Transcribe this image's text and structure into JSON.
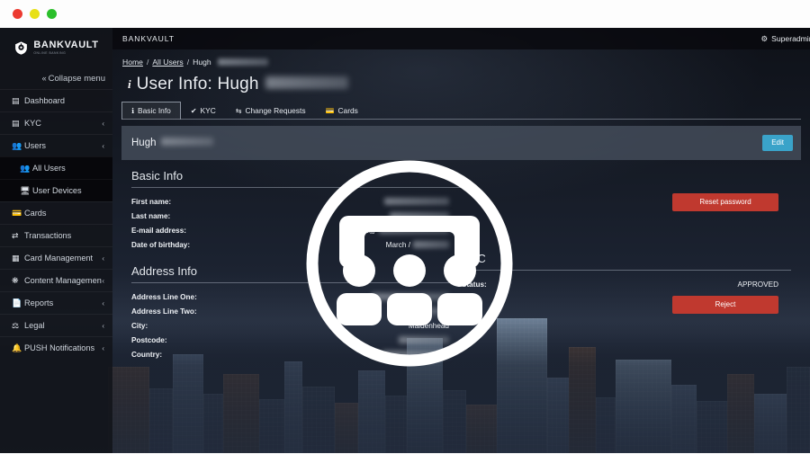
{
  "window": {
    "controls": [
      "close",
      "minimize",
      "maximize"
    ]
  },
  "sidebar": {
    "brand": {
      "name": "BANKVAULT",
      "tagline": "ONLINE BANKING",
      "logo_icon": "vault-shield-icon"
    },
    "collapse": {
      "label": "Collapse menu",
      "icon": "double-chevron-left-icon"
    },
    "items": [
      {
        "label": "Dashboard",
        "icon": "dashboard-icon",
        "expandable": false,
        "active": false,
        "sub": false
      },
      {
        "label": "KYC",
        "icon": "kyc-icon",
        "expandable": true,
        "active": false,
        "sub": false
      },
      {
        "label": "Users",
        "icon": "users-icon",
        "expandable": true,
        "active": true,
        "sub": false
      },
      {
        "label": "All Users",
        "icon": "all-users-icon",
        "expandable": false,
        "active": true,
        "sub": true
      },
      {
        "label": "User Devices",
        "icon": "device-icon",
        "expandable": false,
        "active": false,
        "sub": true
      },
      {
        "label": "Cards",
        "icon": "card-icon",
        "expandable": false,
        "active": false,
        "sub": false
      },
      {
        "label": "Transactions",
        "icon": "transactions-icon",
        "expandable": false,
        "active": false,
        "sub": false
      },
      {
        "label": "Card Management",
        "icon": "card-management-icon",
        "expandable": true,
        "active": false,
        "sub": false
      },
      {
        "label": "Content Management",
        "icon": "content-management-icon",
        "expandable": true,
        "active": false,
        "sub": false
      },
      {
        "label": "Reports",
        "icon": "reports-icon",
        "expandable": true,
        "active": false,
        "sub": false
      },
      {
        "label": "Legal",
        "icon": "legal-icon",
        "expandable": true,
        "active": false,
        "sub": false
      },
      {
        "label": "PUSH Notifications",
        "icon": "bell-icon",
        "expandable": true,
        "active": false,
        "sub": false
      }
    ],
    "expand_arrow": "‹"
  },
  "topbar": {
    "title": "BANKVAULT",
    "user": "Superadmin",
    "user_icon": "gear-icon",
    "caret": "▾"
  },
  "breadcrumb": {
    "items": [
      {
        "label": "Home",
        "link": true
      },
      {
        "label": "All Users",
        "link": true
      },
      {
        "label": "Hugh",
        "link": false,
        "redacted_after": true
      }
    ],
    "separator": "/"
  },
  "page": {
    "icon": "info-icon",
    "title": "User Info: Hugh",
    "title_redacted": true
  },
  "tabs": [
    {
      "label": "Basic Info",
      "icon": "info-icon",
      "active": true
    },
    {
      "label": "KYC",
      "icon": "check-icon",
      "active": false
    },
    {
      "label": "Change Requests",
      "icon": "exchange-icon",
      "active": false
    },
    {
      "label": "Cards",
      "icon": "card-icon",
      "active": false
    }
  ],
  "panel": {
    "header_name": "Hugh",
    "header_name_redacted": true,
    "edit_label": "Edit"
  },
  "basic_info": {
    "title": "Basic Info",
    "rows": [
      {
        "label": "First name:",
        "value": "",
        "redacted": true
      },
      {
        "label": "Last name:",
        "value": "",
        "redacted": true
      },
      {
        "label": "E-mail address:",
        "value": "hugh@",
        "redacted": true
      },
      {
        "label": "Date of birthday:",
        "value": "March /",
        "redacted": true
      }
    ],
    "reset_password_label": "Reset password"
  },
  "address_info": {
    "title": "Address Info",
    "rows": [
      {
        "label": "Address Line One:",
        "value": "",
        "redacted": true
      },
      {
        "label": "Address Line Two:",
        "value": "",
        "redacted": true
      },
      {
        "label": "City:",
        "value": "Maidenhead",
        "redacted": false
      },
      {
        "label": "Postcode:",
        "value": "",
        "redacted": true
      },
      {
        "label": "Country:",
        "value": "",
        "redacted": true
      }
    ]
  },
  "kyc": {
    "title": "KYC",
    "status_label": "Status:",
    "status_value": "APPROVED",
    "reject_label": "Reject"
  },
  "overlay": {
    "icon": "group-of-users-icon",
    "shape": "circle-outline"
  },
  "colors": {
    "accent_blue": "#3aa3c9",
    "danger_red": "#c0392f",
    "panel_header": "#464f5c",
    "sidebar_bg": "#12141a",
    "text_light": "#eef1f5"
  }
}
